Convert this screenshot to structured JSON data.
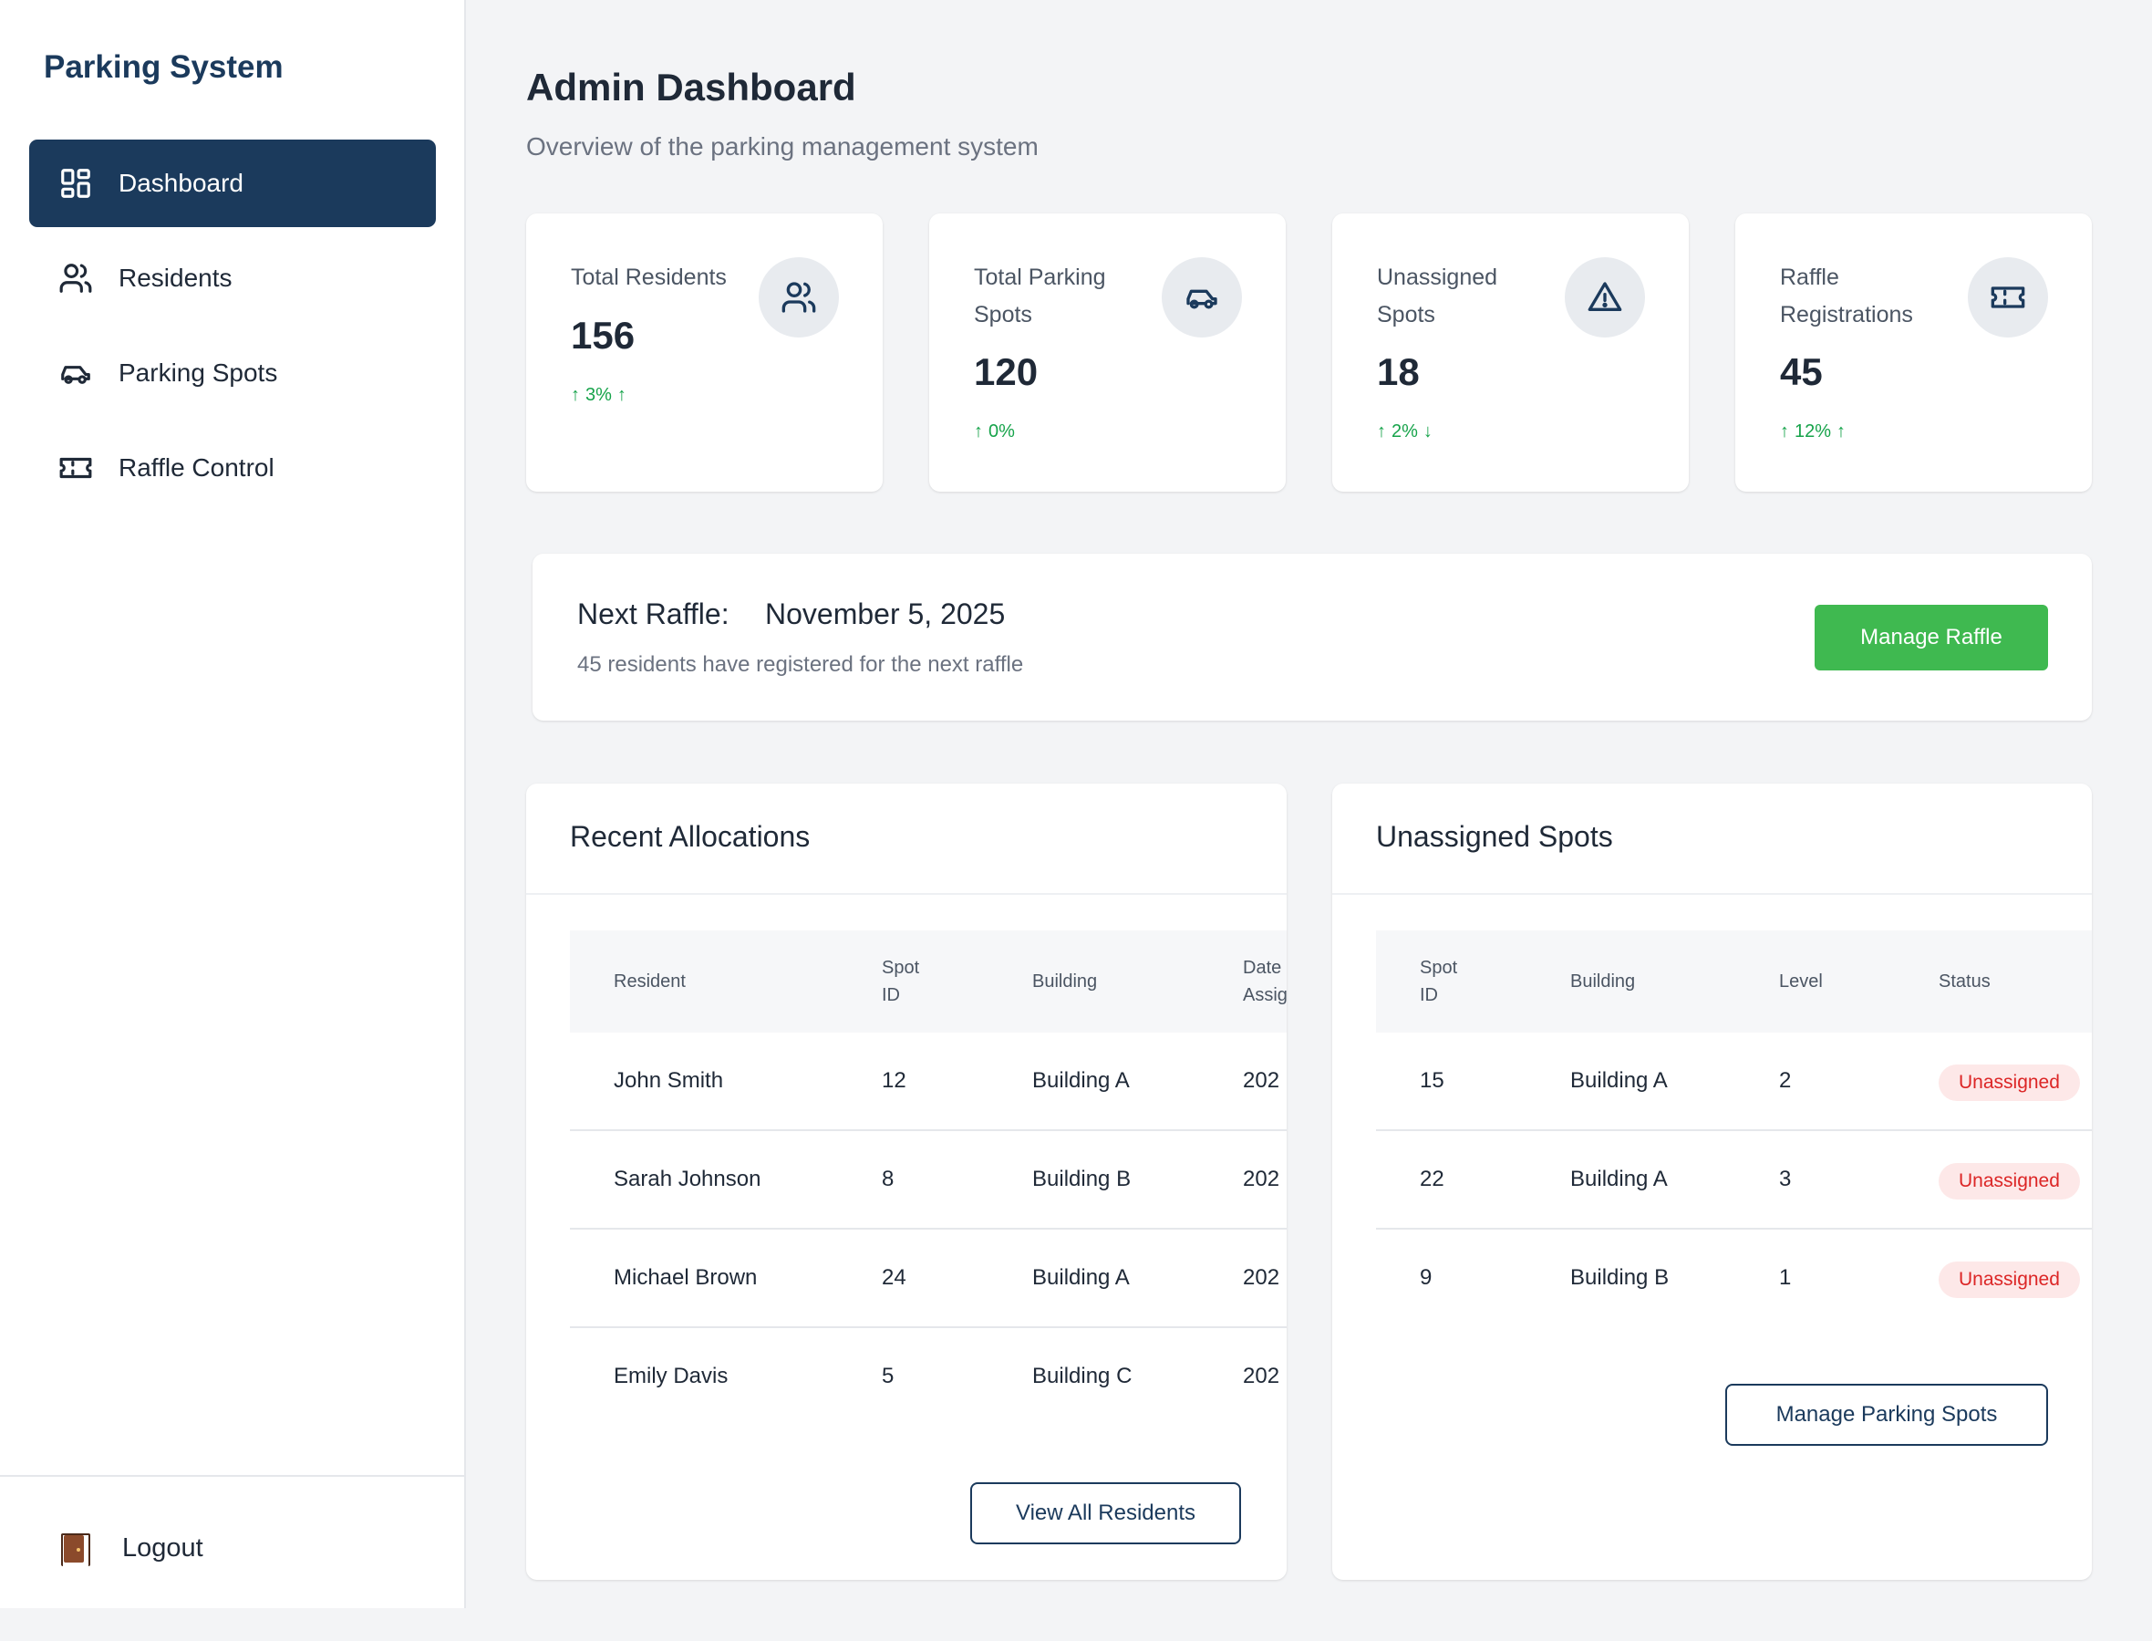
{
  "sidebar": {
    "brand": "Parking System",
    "items": [
      {
        "label": "Dashboard",
        "icon": "dashboard-icon",
        "active": true
      },
      {
        "label": "Residents",
        "icon": "users-icon"
      },
      {
        "label": "Parking Spots",
        "icon": "car-icon"
      },
      {
        "label": "Raffle Control",
        "icon": "ticket-icon"
      }
    ],
    "logout": "Logout"
  },
  "header": {
    "title": "Admin Dashboard",
    "subtitle": "Overview of the parking management system"
  },
  "stats": [
    {
      "label": "Total Residents",
      "value": "156",
      "change": "3%",
      "trend": "up",
      "icon": "users-icon"
    },
    {
      "label": "Total Parking Spots",
      "value": "120",
      "change": "0%",
      "trend": "none",
      "icon": "car-icon"
    },
    {
      "label": "Unassigned Spots",
      "value": "18",
      "change": "2%",
      "trend": "down",
      "icon": "warning-icon"
    },
    {
      "label": "Raffle Registrations",
      "value": "45",
      "change": "12%",
      "trend": "up",
      "icon": "ticket-icon"
    }
  ],
  "raffle": {
    "label": "Next Raffle:",
    "date": "November 5, 2025",
    "summary": "45 residents have registered for the next raffle",
    "button": "Manage Raffle"
  },
  "allocations": {
    "title": "Recent Allocations",
    "headers": [
      "Resident",
      "Spot ID",
      "Building",
      "Date Assigned"
    ],
    "rows": [
      [
        "John Smith",
        "12",
        "Building A",
        "202"
      ],
      [
        "Sarah Johnson",
        "8",
        "Building B",
        "202"
      ],
      [
        "Michael Brown",
        "24",
        "Building A",
        "202"
      ],
      [
        "Emily Davis",
        "5",
        "Building C",
        "202"
      ]
    ],
    "button": "View All Residents"
  },
  "unassigned": {
    "title": "Unassigned Spots",
    "headers": [
      "Spot ID",
      "Building",
      "Level",
      "Status"
    ],
    "rows": [
      [
        "15",
        "Building A",
        "2",
        "Unassigned"
      ],
      [
        "22",
        "Building A",
        "3",
        "Unassigned"
      ],
      [
        "9",
        "Building B",
        "1",
        "Unassigned"
      ]
    ],
    "button": "Manage Parking Spots"
  },
  "colors": {
    "primary": "#1b3a5c",
    "success": "#3fb950",
    "danger": "#dc2626",
    "background": "#f3f4f6"
  }
}
